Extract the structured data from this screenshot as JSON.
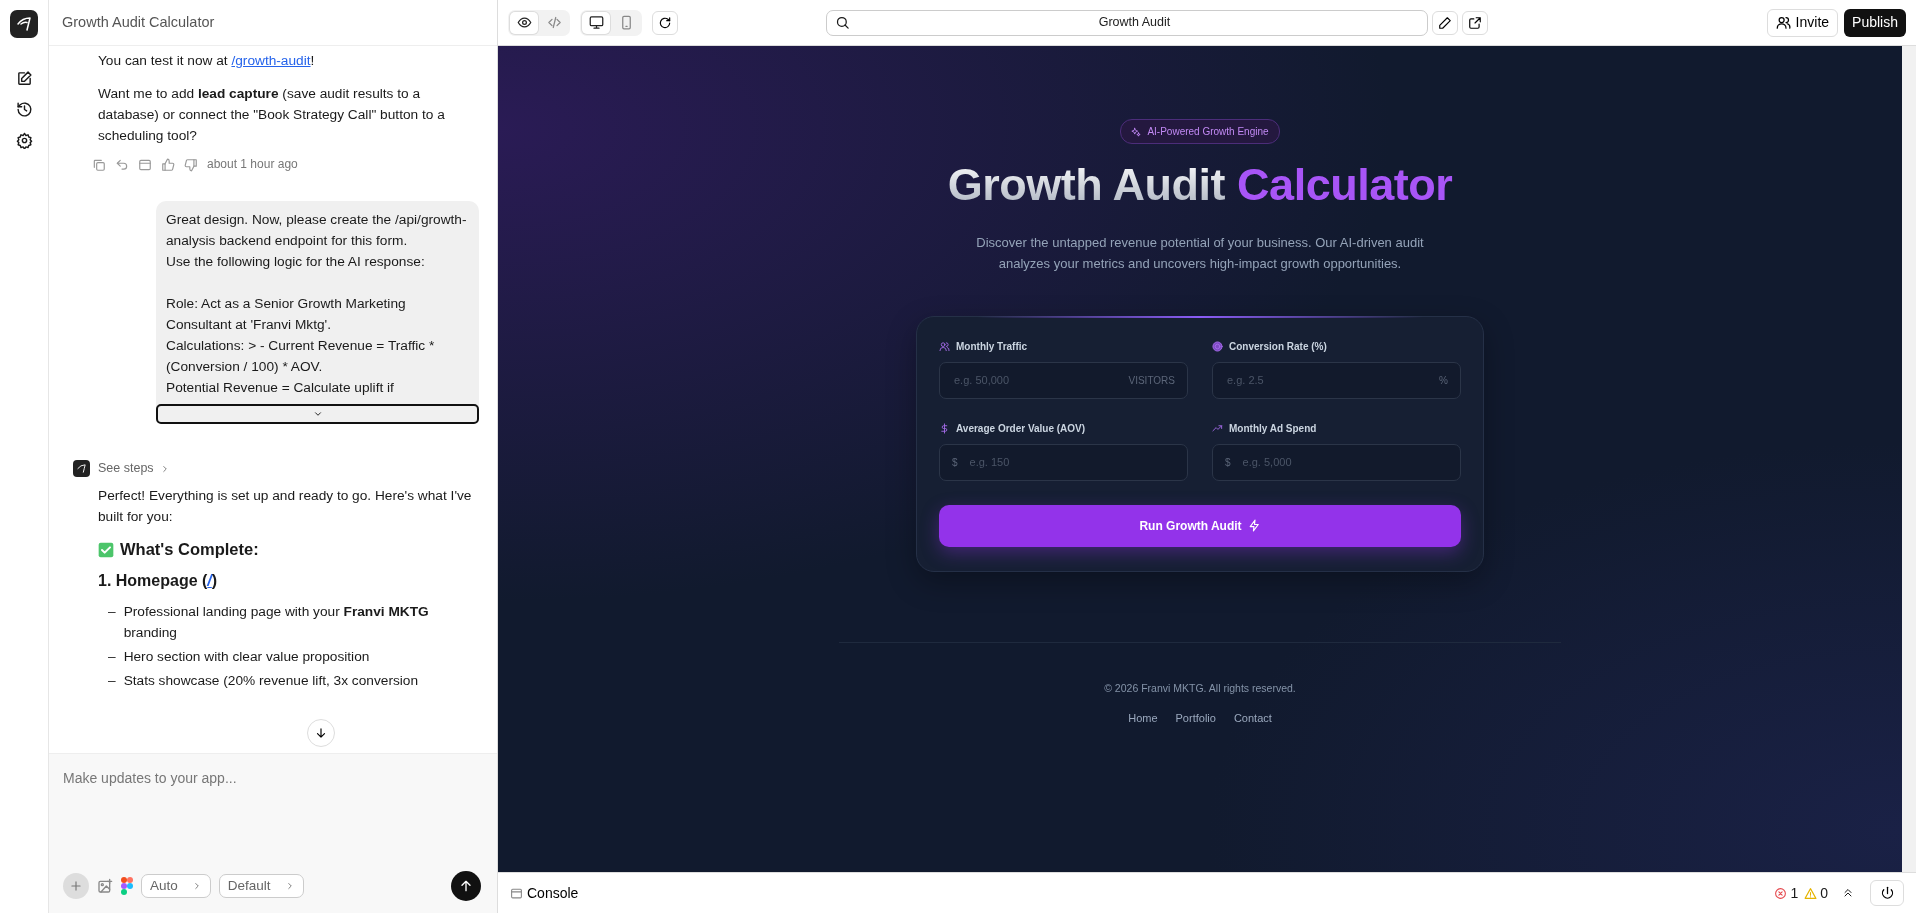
{
  "chat_header": {
    "title": "Growth Audit Calculator"
  },
  "assistant_reply": {
    "test_line": {
      "before": "You can test it now at ",
      "link": "/growth-audit",
      "after": "!"
    },
    "question": "Want me to add **lead capture** (save audit results to a database) or connect the \"Book Strategy Call\" button to a scheduling tool?",
    "timestamp": "about 1 hour ago"
  },
  "user_message": {
    "paragraphs": [
      "Great design. Now, please create the /api/growth-analysis backend endpoint for this form.\nUse the following logic for the AI response:",
      "Role: Act as a Senior Growth Marketing Consultant at 'Franvi Mktg'.\nCalculations: > - Current Revenue = Traffic * (Conversion / 100) * AOV.\nPotential Revenue = Calculate uplift if"
    ],
    "collapsed": true
  },
  "summary_reply": {
    "steps_label": "See steps",
    "intro": "Perfect! Everything is set up and ready to go. Here's what I've built for you:",
    "heading": "What's Complete:",
    "section": {
      "before": "1. Homepage (",
      "link": "/",
      "after": ")"
    },
    "bullet_marker": "–",
    "bullets": [
      "Professional landing page with your **Franvi MKTG** branding",
      "Hero section with clear value proposition",
      "Stats showcase (20% revenue lift, 3x conversion"
    ]
  },
  "composer": {
    "placeholder": "Make updates to your app...",
    "modes": [
      "Auto",
      "Default"
    ]
  },
  "toolbar": {
    "view_modes": [
      {
        "kind": "preview",
        "selected": true
      },
      {
        "kind": "code",
        "selected": false
      }
    ],
    "devices": [
      {
        "kind": "desktop",
        "selected": true
      },
      {
        "kind": "mobile",
        "selected": false
      }
    ],
    "address": "Growth Audit",
    "invite": "Invite",
    "publish": "Publish"
  },
  "preview": {
    "badge": "AI-Powered Growth Engine",
    "title_plain": "Growth Audit",
    "title_accent": "Calculator",
    "subtitle": "Discover the untapped revenue potential of your business. Our AI-driven audit analyzes your metrics and uncovers high-impact growth opportunities.",
    "fields": [
      {
        "kind": "users",
        "label": "Monthly Traffic",
        "placeholder": "e.g. 50,000",
        "suffix": "VISITORS"
      },
      {
        "kind": "target",
        "label": "Conversion Rate (%)",
        "placeholder": "e.g. 2.5",
        "suffix": "%"
      },
      {
        "kind": "dollar",
        "label": "Average Order Value (AOV)",
        "placeholder": "e.g. 150",
        "prefix": "$"
      },
      {
        "kind": "trend",
        "label": "Monthly Ad Spend",
        "placeholder": "e.g. 5,000",
        "prefix": "$"
      }
    ],
    "submit": "Run Growth Audit",
    "copyright": "© 2026 Franvi MKTG. All rights reserved.",
    "footer_links": [
      "Home",
      "Portfolio",
      "Contact"
    ]
  },
  "console": {
    "label": "Console",
    "errors": "1",
    "warnings": "0"
  }
}
